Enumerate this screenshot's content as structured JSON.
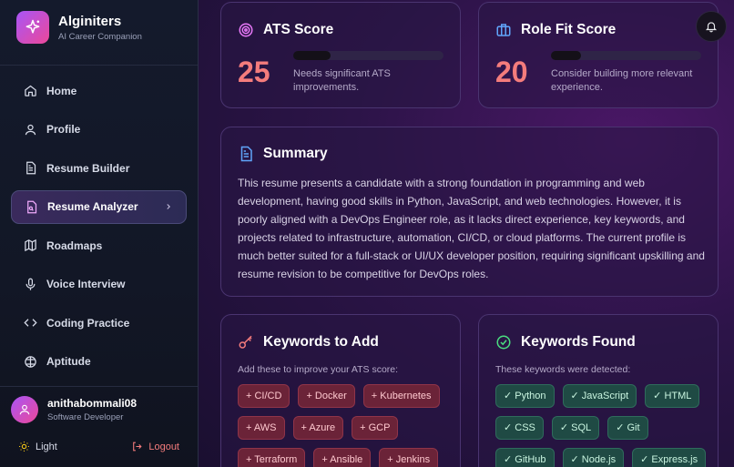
{
  "brand": {
    "name": "Alginiters",
    "subtitle": "AI Career Companion"
  },
  "nav": [
    {
      "label": "Home",
      "icon": "home-icon"
    },
    {
      "label": "Profile",
      "icon": "user-icon"
    },
    {
      "label": "Resume Builder",
      "icon": "document-icon"
    },
    {
      "label": "Resume Analyzer",
      "icon": "file-search-icon",
      "active": true
    },
    {
      "label": "Roadmaps",
      "icon": "map-icon"
    },
    {
      "label": "Voice Interview",
      "icon": "microphone-icon"
    },
    {
      "label": "Coding Practice",
      "icon": "code-icon"
    },
    {
      "label": "Aptitude",
      "icon": "brain-icon"
    }
  ],
  "user": {
    "name": "anithabommali08",
    "role": "Software Developer"
  },
  "theme_label": "Light",
  "logout_label": "Logout",
  "ats": {
    "title": "ATS Score",
    "score": "25",
    "desc": "Needs significant ATS improvements.",
    "progress": 0.25
  },
  "role_fit": {
    "title": "Role Fit Score",
    "score": "20",
    "desc": "Consider building more relevant experience.",
    "progress": 0.2
  },
  "summary": {
    "title": "Summary",
    "text": "This resume presents a candidate with a strong foundation in programming and web development, having good skills in Python, JavaScript, and web technologies. However, it is poorly aligned with a DevOps Engineer role, as it lacks direct experience, key keywords, and projects related to infrastructure, automation, CI/CD, or cloud platforms. The current profile is much better suited for a full-stack or UI/UX developer position, requiring significant upskilling and resume revision to be competitive for DevOps roles."
  },
  "keywords_add": {
    "title": "Keywords to Add",
    "subtitle": "Add these to improve your ATS score:",
    "items": [
      "+ CI/CD",
      "+ Docker",
      "+ Kubernetes",
      "+ AWS",
      "+ Azure",
      "+ GCP",
      "+ Terraform",
      "+ Ansible",
      "+ Jenkins"
    ]
  },
  "keywords_found": {
    "title": "Keywords Found",
    "subtitle": "These keywords were detected:",
    "items": [
      "✓ Python",
      "✓ JavaScript",
      "✓ HTML",
      "✓ CSS",
      "✓ SQL",
      "✓ Git",
      "✓ GitHub",
      "✓ Node.js",
      "✓ Express.js"
    ]
  },
  "colors": {
    "accent": "#a855f7",
    "score": "#f47c7c",
    "chip_add": "#6b2338",
    "chip_found": "#1f4a44"
  }
}
